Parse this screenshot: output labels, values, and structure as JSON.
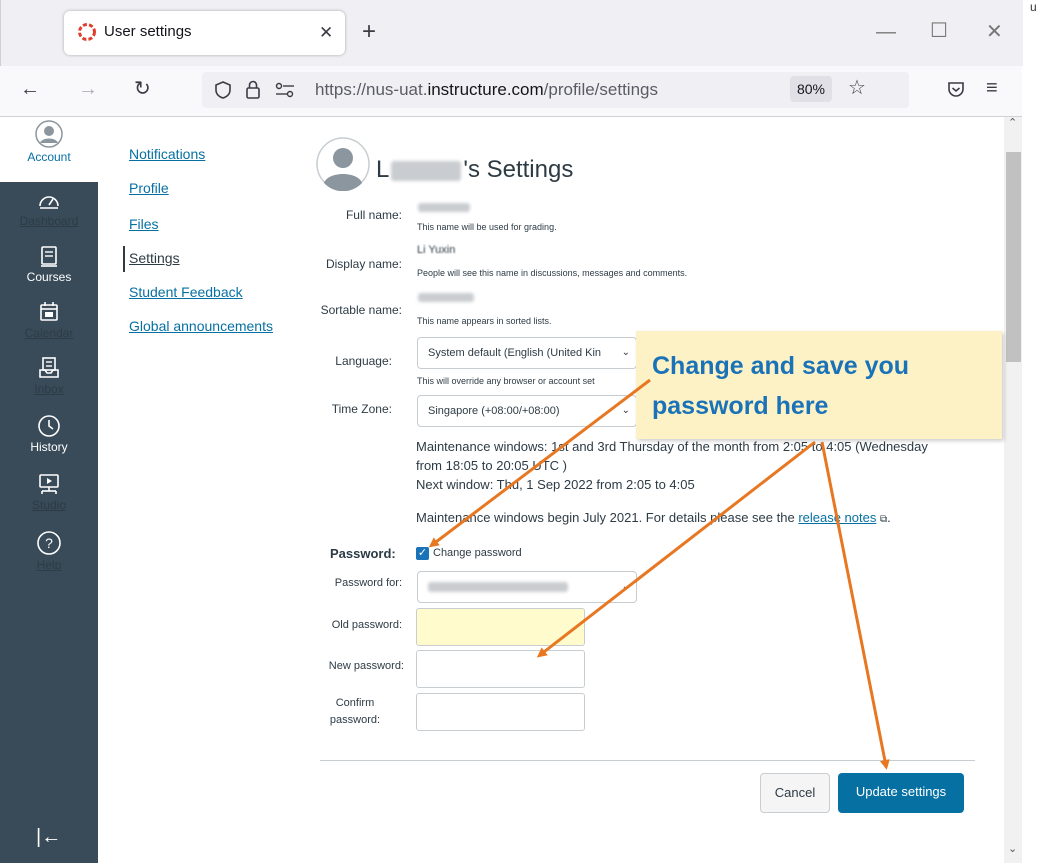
{
  "browser": {
    "tab_title": "User settings",
    "new_tab": "+",
    "url_prefix": "https://nus-uat.",
    "url_domain": "instructure.com",
    "url_path": "/profile/settings",
    "zoom": "80%",
    "window_controls": [
      "—",
      "☐",
      "✕"
    ],
    "corner_text": "u"
  },
  "global_nav": {
    "account": "Account",
    "items": [
      {
        "label": "Dashboard",
        "icon": "dashboard-icon"
      },
      {
        "label": "Courses",
        "icon": "courses-icon"
      },
      {
        "label": "Calendar",
        "icon": "calendar-icon"
      },
      {
        "label": "Inbox",
        "icon": "inbox-icon"
      },
      {
        "label": "History",
        "icon": "history-icon"
      },
      {
        "label": "Studio",
        "icon": "studio-icon"
      },
      {
        "label": "Help",
        "icon": "help-icon"
      }
    ],
    "collapse_glyph": "|←"
  },
  "settings_menu": {
    "items": [
      "Notifications",
      "Profile",
      "Files",
      "Settings",
      "Student Feedback",
      "Global announcements"
    ],
    "active": "Settings"
  },
  "profile": {
    "title_prefix": "L",
    "title_suffix": "'s Settings",
    "full_name_label": "Full name:",
    "full_name_help": "This name will be used for grading.",
    "display_name_label": "Display name:",
    "display_name_value": "Li Yuxin",
    "display_name_help": "People will see this name in discussions, messages and comments.",
    "sortable_name_label": "Sortable name:",
    "sortable_name_help": "This name appears in sorted lists.",
    "language_label": "Language:",
    "language_value": "System default (English (United Kin",
    "language_help": "This will override any browser or account set",
    "timezone_label": "Time Zone:",
    "timezone_value": "Singapore (+08:00/+08:00)",
    "maint_line1": "Maintenance windows: 1st and 3rd Thursday of the month from 2:05 to 4:05 (Wednesday",
    "maint_line2": "from 18:05 to 20:05 UTC )",
    "maint_line3": "Next window: Thu, 1 Sep 2022 from 2:05 to 4:05",
    "maint_line4": "Maintenance windows begin July 2021. For details please see the",
    "release_notes": "release notes",
    "period": ".",
    "password_label": "Password:",
    "change_password": "Change password",
    "change_password_checked": true,
    "password_for_label": "Password for:",
    "old_password_label": "Old password:",
    "new_password_label": "New password:",
    "confirm_password_label_1": "Confirm",
    "confirm_password_label_2": "password:",
    "cancel": "Cancel",
    "update": "Update settings"
  },
  "annotation": {
    "callout_line1": "Change and save you",
    "callout_line2": "password here",
    "arrow_color": "#e87722"
  },
  "colors": {
    "nav_bg": "#394b58",
    "link": "#0770a3",
    "primary_button": "#0770a3",
    "old_password_bg": "#fffbcc"
  }
}
